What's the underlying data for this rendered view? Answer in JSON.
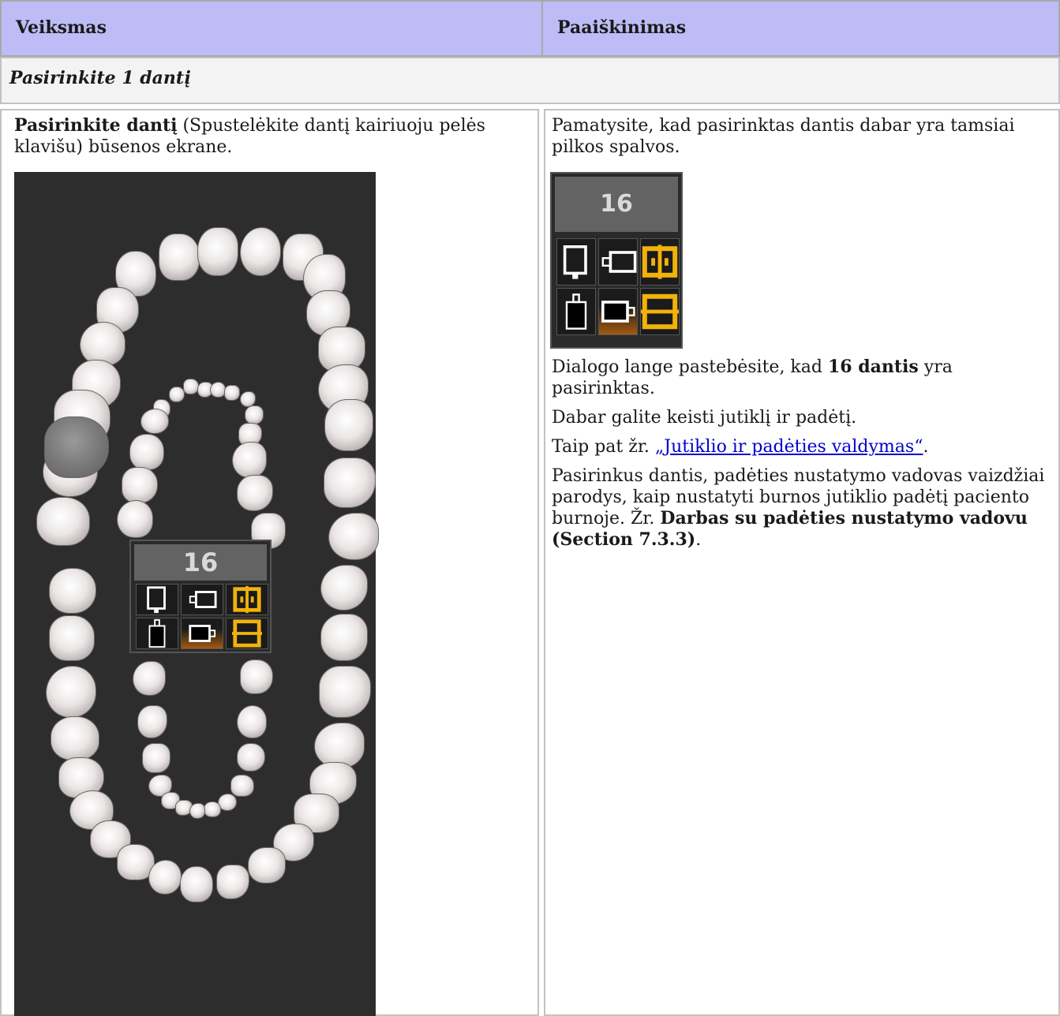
{
  "table": {
    "col_action": "Veiksmas",
    "col_explanation": "Paaiškinimas",
    "section_title": "Pasirinkite 1 dantį"
  },
  "step": {
    "action_bold": "Pasirinkite dantį",
    "action_rest": " (Spustelėkite dantį kairiuoju pelės klavišu) būsenos ekrane.",
    "result_intro": "Pamatysite, kad pasirinktas dantis dabar yra tamsiai pilkos spalvos.",
    "dialog_pre": "Dialogo lange pastebėsite, kad ",
    "dialog_bold": "16 dantis",
    "dialog_post": " yra pasirinktas.",
    "change_text": "Dabar galite keisti jutiklį ir padėtį.",
    "see_also_pre": "Taip pat žr. ",
    "see_also_link": "„Jutiklio ir padėties valdymas“",
    "see_also_post": ".",
    "guide_text": "Pasirinkus dantis, padėties nustatymo vadovas vaizdžiai parodys, kaip nustatyti burnos jutiklio padėtį paciento burnoje. Žr. ",
    "guide_bold": "Darbas su padėties nustatymo vadovu (Section 7.3.3)",
    "guide_post": "."
  },
  "tooth_panel": {
    "number": "16",
    "selected_tooth": "16",
    "icons": [
      "sensor-vertical-icon",
      "sensor-horizontal-icon",
      "mirror-vertical-icon",
      "sensor-vertical-alt-icon",
      "sensor-horizontal-active-icon",
      "mirror-horizontal-icon"
    ],
    "accent": "#f2b20a"
  }
}
